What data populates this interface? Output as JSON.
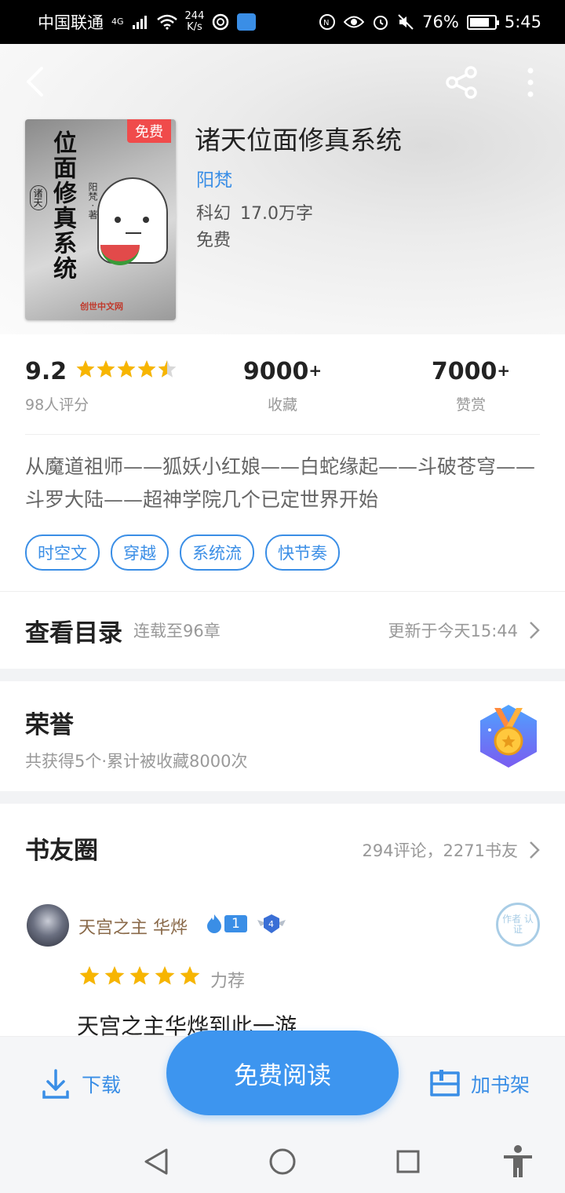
{
  "status_bar": {
    "carrier": "中国联通",
    "network_type": "4G",
    "speed_value": "244",
    "speed_unit": "K/s",
    "battery": "76%",
    "time": "5:45"
  },
  "book": {
    "cover_title": "位面修真系统",
    "cover_series": "诸天",
    "cover_author": "阳梵 · 著",
    "cover_badge": "免费",
    "cover_publisher": "创世中文网",
    "title": "诸天位面修真系统",
    "author": "阳梵",
    "genre": "科幻",
    "word_count": "17.0万字",
    "price": "免费"
  },
  "stats": {
    "rating": "9.2",
    "rating_stars": 4.5,
    "rating_count": "98人评分",
    "favorites": "9000",
    "favorites_suffix": "+",
    "favorites_label": "收藏",
    "rewards": "7000",
    "rewards_suffix": "+",
    "rewards_label": "赞赏"
  },
  "intro": "从魔道祖师——狐妖小红娘——白蛇缘起——斗破苍穹——斗罗大陆——超神学院几个已定世界开始",
  "tags": [
    "时空文",
    "穿越",
    "系统流",
    "快节奏"
  ],
  "catalog": {
    "title": "查看目录",
    "status": "连载至96章",
    "updated": "更新于今天15:44"
  },
  "honor": {
    "title": "荣誉",
    "summary": "共获得5个·累计被收藏8000次"
  },
  "book_circle": {
    "title": "书友圈",
    "count": "294评论，2271书友",
    "review": {
      "user": "天宫之主 华烨",
      "level": "1",
      "fan_level": "4",
      "stamp": "作者 认证",
      "stars": 5,
      "recommend": "力荐",
      "text": "天宫之主华烨到此一游"
    }
  },
  "actions": {
    "download": "下载",
    "read": "免费阅读",
    "add_shelf": "加书架"
  },
  "colors": {
    "accent": "#3a8ee6",
    "star": "#f7b500",
    "badge_red": "#f04b4b"
  }
}
